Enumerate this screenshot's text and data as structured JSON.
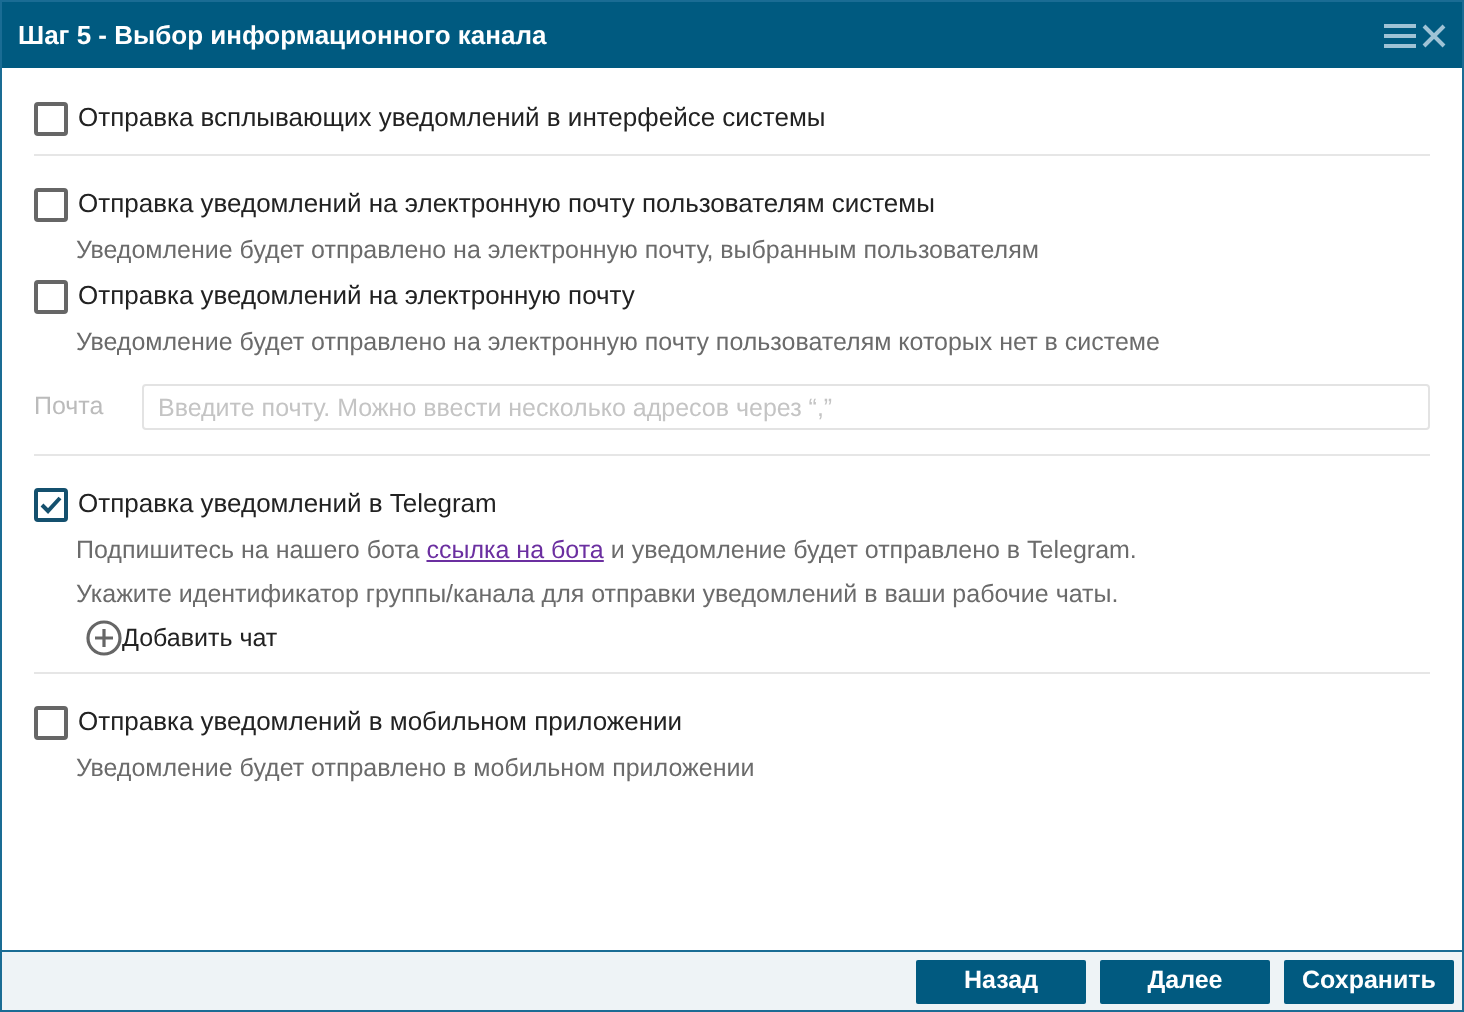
{
  "window": {
    "title": "Шаг 5 - Выбор информационного канала"
  },
  "sections": [
    {
      "options": [
        {
          "label": "Отправка всплывающих уведомлений в интерфейсе системы",
          "checked": false
        }
      ]
    },
    {
      "options": [
        {
          "label": "Отправка уведомлений на электронную почту пользователям системы",
          "checked": false,
          "notes": [
            {
              "kind": "text",
              "text": "Уведомление будет отправлено на электронную почту, выбранным пользователям"
            }
          ]
        },
        {
          "label": "Отправка уведомлений на электронную почту",
          "checked": false,
          "notes": [
            {
              "kind": "text",
              "text": "Уведомление будет отправлено на электронную почту пользователям которых нет в системе"
            }
          ]
        }
      ],
      "email_field": {
        "label": "Почта",
        "placeholder": "Введите почту. Можно ввести несколько адресов через “,”"
      }
    },
    {
      "options": [
        {
          "label": "Отправка уведомлений в Telegram",
          "checked": true,
          "notes": [
            {
              "kind": "link",
              "before": "Подпишитесь на нашего бота",
              "link": "ссылка на бота",
              "after": "и уведомление будет отправлено в Telegram."
            },
            {
              "kind": "text",
              "text": "Укажите идентификатор группы/канала для отправки уведомлений в ваши рабочие чаты."
            }
          ]
        }
      ],
      "add_chat": "Добавить чат"
    },
    {
      "options": [
        {
          "label": "Отправка уведомлений в мобильном приложении",
          "checked": false,
          "notes": [
            {
              "kind": "text",
              "text": "Уведомление будет отправлено в мобильном приложении"
            }
          ]
        }
      ]
    }
  ],
  "buttons": [
    "Назад",
    "Далее",
    "Сохранить"
  ]
}
